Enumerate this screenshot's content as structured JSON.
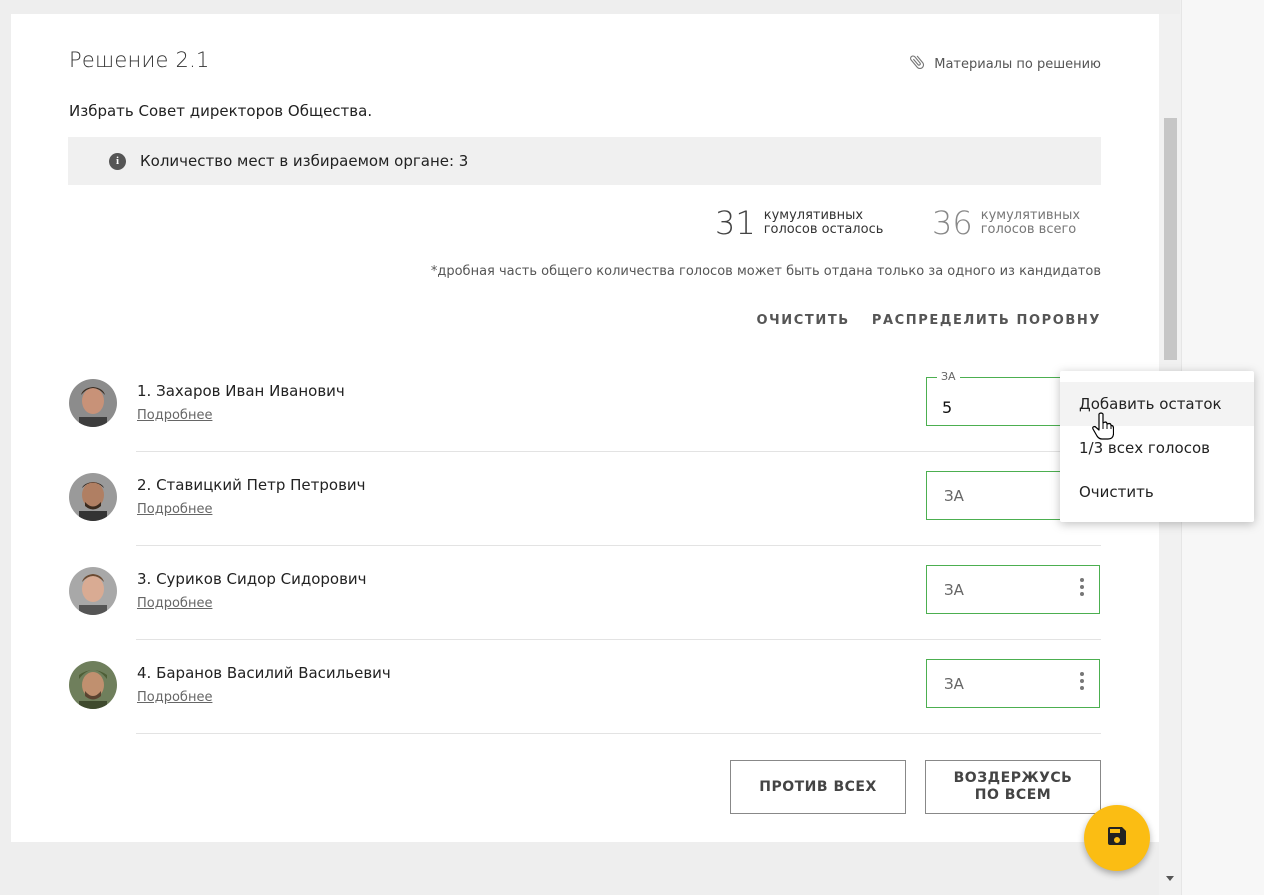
{
  "decision": {
    "title": "Решение 2.1",
    "materials_label": "Материалы по решению",
    "description": "Избрать Совет директоров Общества.",
    "info": "Количество мест в избираемом органе: 3"
  },
  "votes": {
    "remaining": {
      "number": "31",
      "label_line1": "кумулятивных",
      "label_line2": "голосов осталось"
    },
    "total": {
      "number": "36",
      "label_line1": "кумулятивных",
      "label_line2": "голосов всего"
    },
    "note": "*дробная часть общего количества голосов может быть отдана только за одного из кандидатов"
  },
  "actions": {
    "clear": "ОЧИСТИТЬ",
    "distribute": "РАСПРЕДЕЛИТЬ ПОРОВНУ"
  },
  "candidates": [
    {
      "name": "1. Захаров Иван Иванович",
      "more": "Подробнее",
      "vote_label": "ЗА",
      "vote_value": "5"
    },
    {
      "name": "2. Ставицкий Петр Петрович",
      "more": "Подробнее",
      "vote_label": "ЗА",
      "vote_value": ""
    },
    {
      "name": "3. Суриков Сидор Сидорович",
      "more": "Подробнее",
      "vote_label": "ЗА",
      "vote_value": ""
    },
    {
      "name": "4. Баранов Василий Васильевич",
      "more": "Подробнее",
      "vote_label": "ЗА",
      "vote_value": ""
    }
  ],
  "buttons": {
    "against_all": "ПРОТИВ ВСЕХ",
    "abstain_line1": "ВОЗДЕРЖУСЬ",
    "abstain_line2": "ПО ВСЕМ"
  },
  "menu": {
    "items": [
      "Добавить остаток",
      "1/3 всех голосов",
      "Очистить"
    ]
  },
  "icons": {
    "materials": "paperclip-icon",
    "info": "info-icon",
    "more_options": "more-vert-icon",
    "save": "save-icon",
    "cursor": "hand-pointer-icon"
  },
  "colors": {
    "accent_green": "#4caf50",
    "fab": "#fbbd13"
  }
}
